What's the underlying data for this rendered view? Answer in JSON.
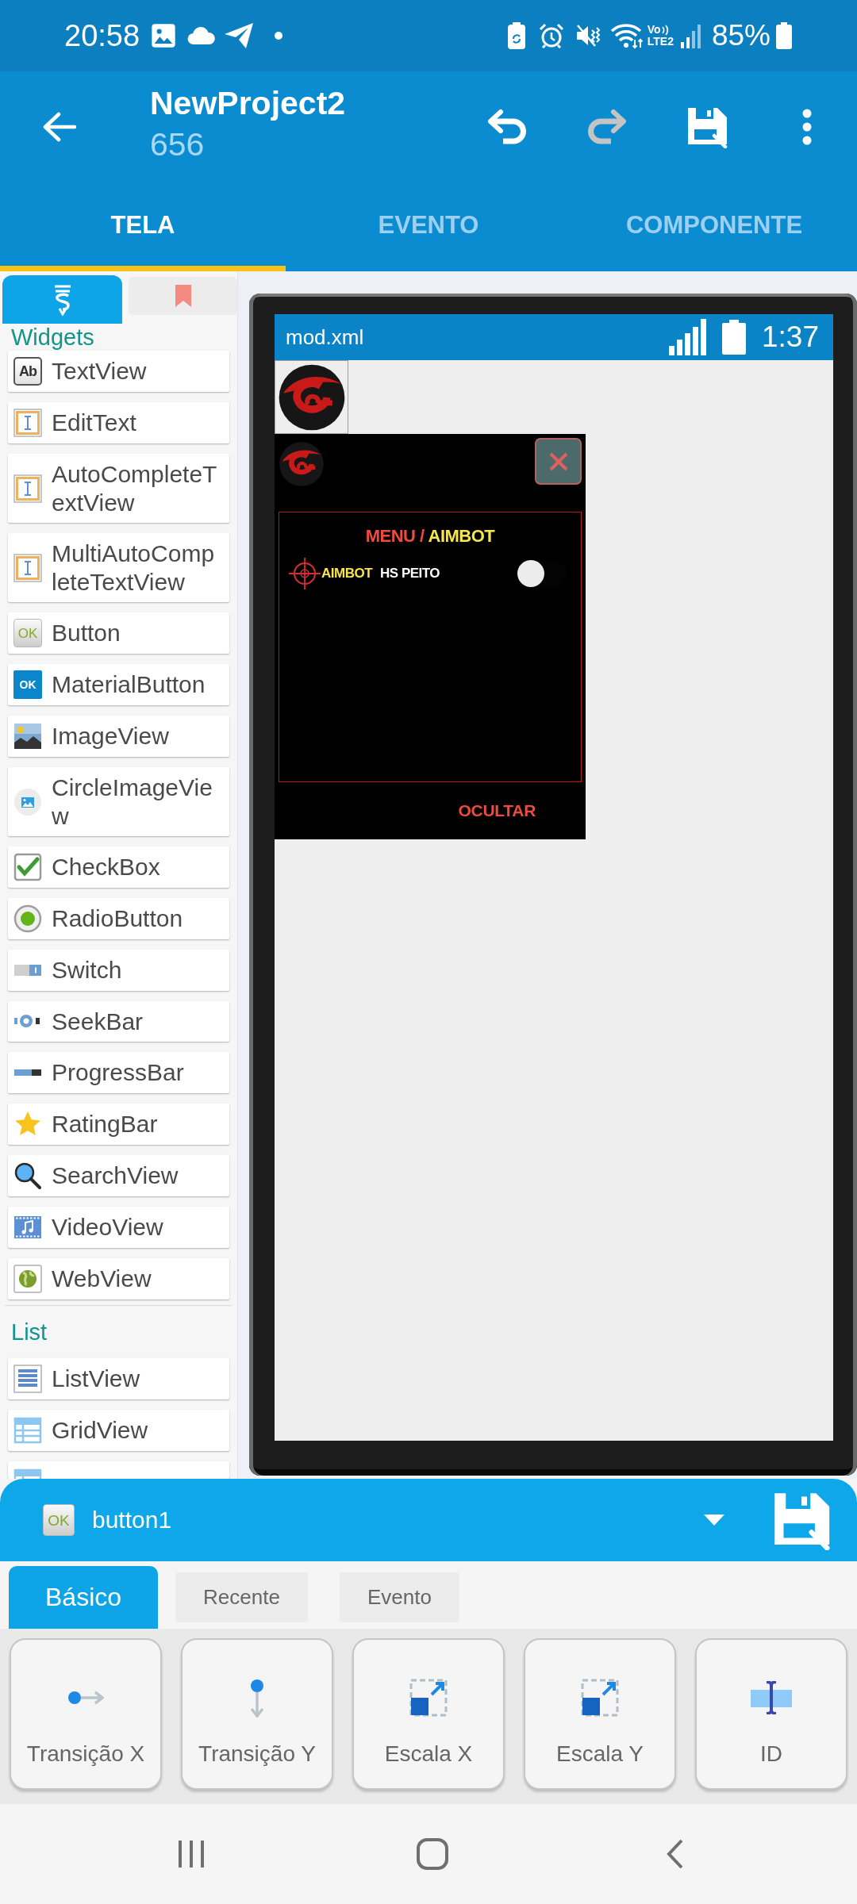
{
  "status_bar": {
    "time": "20:58",
    "network": {
      "volte": "Vo",
      "lte": "LTE2"
    },
    "battery": "85%"
  },
  "app_bar": {
    "title": "NewProject2",
    "subtitle": "656",
    "actions": [
      {
        "kind": "undo",
        "disabled": false
      },
      {
        "kind": "redo",
        "disabled": true
      },
      {
        "kind": "save",
        "disabled": false
      },
      {
        "kind": "more",
        "disabled": false
      }
    ]
  },
  "tabs": [
    {
      "label": "TELA",
      "selected": true
    },
    {
      "label": "EVENTO",
      "selected": false
    },
    {
      "label": "COMPONENTE",
      "selected": false
    }
  ],
  "palette": {
    "tabs": [
      {
        "kind": "widgets",
        "selected": true
      },
      {
        "kind": "bookmarks",
        "selected": false
      }
    ],
    "sections": [
      {
        "title": "Widgets",
        "items": [
          {
            "label": "TextView",
            "kind": "textview",
            "icon_text": "Ab"
          },
          {
            "label": "EditText",
            "kind": "edittext"
          },
          {
            "label": "AutoCompleteTextView",
            "kind": "edittext"
          },
          {
            "label": "MultiAutoCompleteTextView",
            "kind": "edittext"
          },
          {
            "label": "Button",
            "kind": "button",
            "icon_text": "OK"
          },
          {
            "label": "MaterialButton",
            "kind": "materialbutton",
            "icon_text": "OK"
          },
          {
            "label": "ImageView",
            "kind": "imageview"
          },
          {
            "label": "CircleImageView",
            "kind": "circleimageview"
          },
          {
            "label": "CheckBox",
            "kind": "checkbox"
          },
          {
            "label": "RadioButton",
            "kind": "radiobutton"
          },
          {
            "label": "Switch",
            "kind": "switch"
          },
          {
            "label": "SeekBar",
            "kind": "seekbar"
          },
          {
            "label": "ProgressBar",
            "kind": "progressbar"
          },
          {
            "label": "RatingBar",
            "kind": "ratingbar"
          },
          {
            "label": "SearchView",
            "kind": "searchview"
          },
          {
            "label": "VideoView",
            "kind": "videoview"
          },
          {
            "label": "WebView",
            "kind": "webview"
          }
        ]
      },
      {
        "title": "List",
        "items": [
          {
            "label": "ListView",
            "kind": "listview"
          },
          {
            "label": "GridView",
            "kind": "gridview"
          },
          {
            "kind": "gridview"
          }
        ]
      }
    ]
  },
  "preview": {
    "title": "mod.xml",
    "clock": "1:37",
    "menu": {
      "title_prefix": "MENU /",
      "title_highlight": "AIMBOT",
      "options": [
        {
          "label": "AIMBOT",
          "value": "HS PEITO",
          "on": false
        }
      ],
      "hide_button": "OCULTAR"
    }
  },
  "properties_panel": {
    "component": {
      "kind": "button",
      "icon_text": "OK",
      "name": "button1"
    },
    "tabs": [
      {
        "label": "Básico",
        "selected": true
      },
      {
        "label": "Recente",
        "selected": false
      },
      {
        "label": "Evento",
        "selected": false
      }
    ],
    "properties": [
      {
        "label": "Transição X",
        "kind": "translate_x"
      },
      {
        "label": "Transição Y",
        "kind": "translate_y"
      },
      {
        "label": "Escala X",
        "kind": "scale"
      },
      {
        "label": "Escala Y",
        "kind": "scale"
      },
      {
        "label": "ID",
        "kind": "id"
      }
    ]
  }
}
